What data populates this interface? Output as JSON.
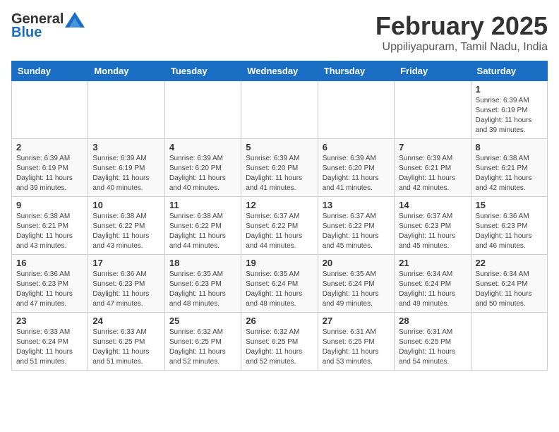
{
  "header": {
    "logo_general": "General",
    "logo_blue": "Blue",
    "month_year": "February 2025",
    "location": "Uppiliyapuram, Tamil Nadu, India"
  },
  "weekdays": [
    "Sunday",
    "Monday",
    "Tuesday",
    "Wednesday",
    "Thursday",
    "Friday",
    "Saturday"
  ],
  "weeks": [
    [
      {
        "day": "",
        "info": ""
      },
      {
        "day": "",
        "info": ""
      },
      {
        "day": "",
        "info": ""
      },
      {
        "day": "",
        "info": ""
      },
      {
        "day": "",
        "info": ""
      },
      {
        "day": "",
        "info": ""
      },
      {
        "day": "1",
        "info": "Sunrise: 6:39 AM\nSunset: 6:19 PM\nDaylight: 11 hours\nand 39 minutes."
      }
    ],
    [
      {
        "day": "2",
        "info": "Sunrise: 6:39 AM\nSunset: 6:19 PM\nDaylight: 11 hours\nand 39 minutes."
      },
      {
        "day": "3",
        "info": "Sunrise: 6:39 AM\nSunset: 6:19 PM\nDaylight: 11 hours\nand 40 minutes."
      },
      {
        "day": "4",
        "info": "Sunrise: 6:39 AM\nSunset: 6:20 PM\nDaylight: 11 hours\nand 40 minutes."
      },
      {
        "day": "5",
        "info": "Sunrise: 6:39 AM\nSunset: 6:20 PM\nDaylight: 11 hours\nand 41 minutes."
      },
      {
        "day": "6",
        "info": "Sunrise: 6:39 AM\nSunset: 6:20 PM\nDaylight: 11 hours\nand 41 minutes."
      },
      {
        "day": "7",
        "info": "Sunrise: 6:39 AM\nSunset: 6:21 PM\nDaylight: 11 hours\nand 42 minutes."
      },
      {
        "day": "8",
        "info": "Sunrise: 6:38 AM\nSunset: 6:21 PM\nDaylight: 11 hours\nand 42 minutes."
      }
    ],
    [
      {
        "day": "9",
        "info": "Sunrise: 6:38 AM\nSunset: 6:21 PM\nDaylight: 11 hours\nand 43 minutes."
      },
      {
        "day": "10",
        "info": "Sunrise: 6:38 AM\nSunset: 6:22 PM\nDaylight: 11 hours\nand 43 minutes."
      },
      {
        "day": "11",
        "info": "Sunrise: 6:38 AM\nSunset: 6:22 PM\nDaylight: 11 hours\nand 44 minutes."
      },
      {
        "day": "12",
        "info": "Sunrise: 6:37 AM\nSunset: 6:22 PM\nDaylight: 11 hours\nand 44 minutes."
      },
      {
        "day": "13",
        "info": "Sunrise: 6:37 AM\nSunset: 6:22 PM\nDaylight: 11 hours\nand 45 minutes."
      },
      {
        "day": "14",
        "info": "Sunrise: 6:37 AM\nSunset: 6:23 PM\nDaylight: 11 hours\nand 45 minutes."
      },
      {
        "day": "15",
        "info": "Sunrise: 6:36 AM\nSunset: 6:23 PM\nDaylight: 11 hours\nand 46 minutes."
      }
    ],
    [
      {
        "day": "16",
        "info": "Sunrise: 6:36 AM\nSunset: 6:23 PM\nDaylight: 11 hours\nand 47 minutes."
      },
      {
        "day": "17",
        "info": "Sunrise: 6:36 AM\nSunset: 6:23 PM\nDaylight: 11 hours\nand 47 minutes."
      },
      {
        "day": "18",
        "info": "Sunrise: 6:35 AM\nSunset: 6:23 PM\nDaylight: 11 hours\nand 48 minutes."
      },
      {
        "day": "19",
        "info": "Sunrise: 6:35 AM\nSunset: 6:24 PM\nDaylight: 11 hours\nand 48 minutes."
      },
      {
        "day": "20",
        "info": "Sunrise: 6:35 AM\nSunset: 6:24 PM\nDaylight: 11 hours\nand 49 minutes."
      },
      {
        "day": "21",
        "info": "Sunrise: 6:34 AM\nSunset: 6:24 PM\nDaylight: 11 hours\nand 49 minutes."
      },
      {
        "day": "22",
        "info": "Sunrise: 6:34 AM\nSunset: 6:24 PM\nDaylight: 11 hours\nand 50 minutes."
      }
    ],
    [
      {
        "day": "23",
        "info": "Sunrise: 6:33 AM\nSunset: 6:24 PM\nDaylight: 11 hours\nand 51 minutes."
      },
      {
        "day": "24",
        "info": "Sunrise: 6:33 AM\nSunset: 6:25 PM\nDaylight: 11 hours\nand 51 minutes."
      },
      {
        "day": "25",
        "info": "Sunrise: 6:32 AM\nSunset: 6:25 PM\nDaylight: 11 hours\nand 52 minutes."
      },
      {
        "day": "26",
        "info": "Sunrise: 6:32 AM\nSunset: 6:25 PM\nDaylight: 11 hours\nand 52 minutes."
      },
      {
        "day": "27",
        "info": "Sunrise: 6:31 AM\nSunset: 6:25 PM\nDaylight: 11 hours\nand 53 minutes."
      },
      {
        "day": "28",
        "info": "Sunrise: 6:31 AM\nSunset: 6:25 PM\nDaylight: 11 hours\nand 54 minutes."
      },
      {
        "day": "",
        "info": ""
      }
    ]
  ]
}
